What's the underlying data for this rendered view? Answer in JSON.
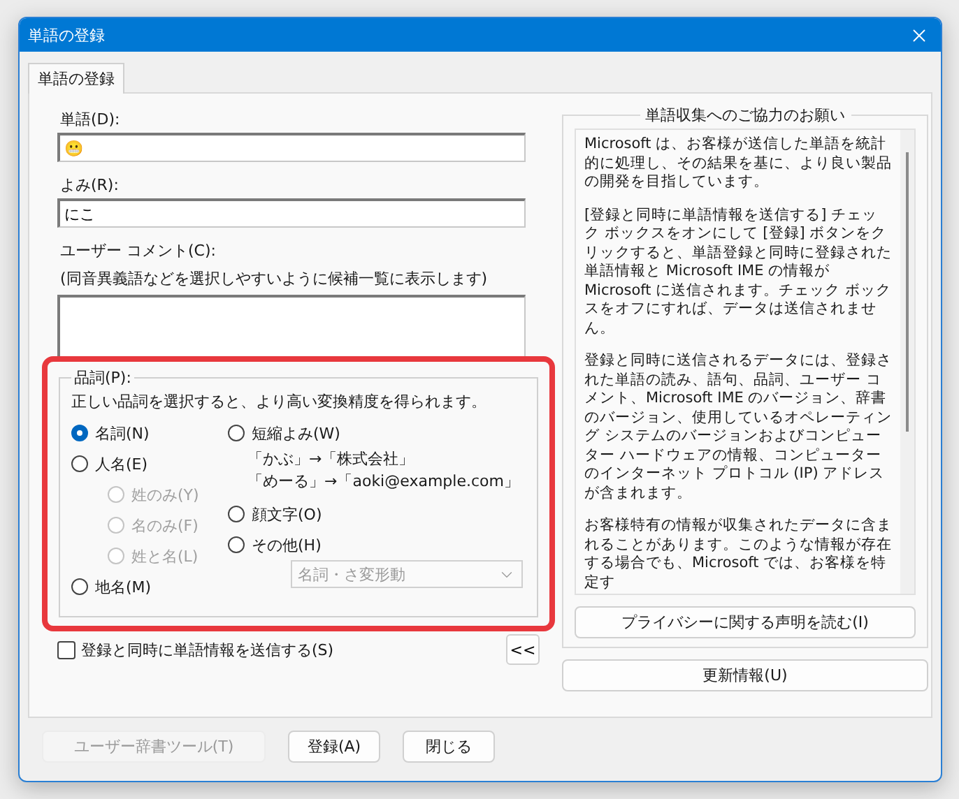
{
  "window": {
    "title": "単語の登録"
  },
  "tabs": [
    {
      "label": "単語の登録",
      "selected": true
    }
  ],
  "word": {
    "label": "単語(D):",
    "value": "😬"
  },
  "reading": {
    "label": "よみ(R):",
    "value": "にこ"
  },
  "comment": {
    "label": "ユーザー コメント(C):",
    "hint": "(同音異義語などを選択しやすいように候補一覧に表示します)"
  },
  "part_of_speech": {
    "label": "品詞(P):",
    "description": "正しい品詞を選択すると、より高い変換精度を得られます。",
    "left_options": [
      {
        "label": "名詞(N)",
        "selected": true,
        "disabled": false
      },
      {
        "label": "人名(E)",
        "selected": false,
        "disabled": false,
        "children": [
          {
            "label": "姓のみ(Y)",
            "selected": false,
            "disabled": true
          },
          {
            "label": "名のみ(F)",
            "selected": false,
            "disabled": true
          },
          {
            "label": "姓と名(L)",
            "selected": false,
            "disabled": true
          }
        ]
      },
      {
        "label": "地名(M)",
        "selected": false,
        "disabled": false
      }
    ],
    "right_options": [
      {
        "label": "短縮よみ(W)",
        "selected": false,
        "disabled": false,
        "examples": [
          "「かぶ」→「株式会社」",
          "「めーる」→「aoki@example.com」"
        ]
      },
      {
        "label": "顔文字(O)",
        "selected": false,
        "disabled": false
      },
      {
        "label": "その他(H)",
        "selected": false,
        "disabled": false
      }
    ],
    "dropdown": {
      "value": "名詞・さ変形動",
      "disabled": true
    }
  },
  "send_checkbox": {
    "label": "登録と同時に単語情報を送信する(S)",
    "checked": false
  },
  "collapse_button": "<<",
  "cooperation": {
    "title": "単語収集へのご協力のお願い",
    "paragraphs": [
      "Microsoft は、お客様が送信した単語を統計的に処理し、その結果を基に、より良い製品の開発を目指しています。",
      "[登録と同時に単語情報を送信する] チェック ボックスをオンにして [登録] ボタンをクリックすると、単語登録と同時に登録された単語情報と Microsoft IME の情報が Microsoft に送信されます。チェック ボックスをオフにすれば、データは送信されません。",
      "登録と同時に送信されるデータには、登録された単語の読み、語句、品詞、ユーザー コメント、Microsoft IME のバージョン、辞書のバージョン、使用しているオペレーティング システムのバージョンおよびコンピューター ハードウェアの情報、コンピューターのインターネット プロトコル (IP) アドレスが含まれます。",
      "お客様特有の情報が収集されたデータに含まれることがあります。このような情報が存在する場合でも、Microsoft では、お客様を特定す"
    ],
    "privacy_button": "プライバシーに関する声明を読む(I)"
  },
  "update_button": "更新情報(U)",
  "footer_buttons": [
    {
      "label": "ユーザー辞書ツール(T)",
      "disabled": true
    },
    {
      "label": "登録(A)",
      "disabled": false
    },
    {
      "label": "閉じる",
      "disabled": false
    }
  ]
}
